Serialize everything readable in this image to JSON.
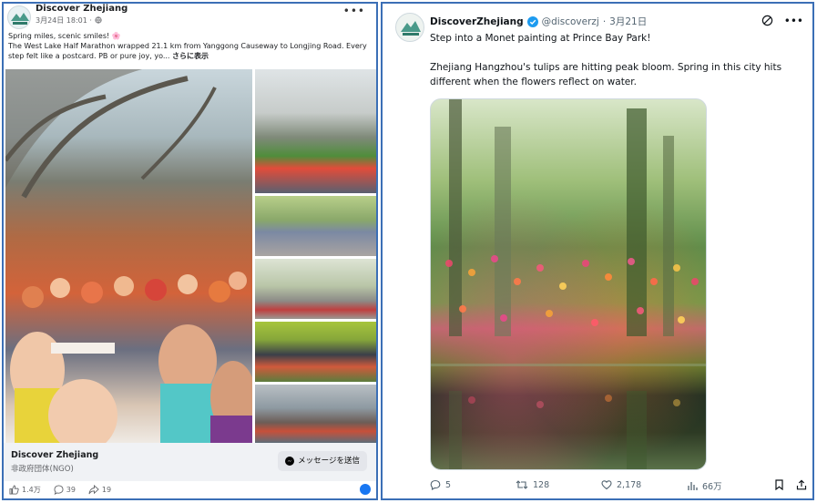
{
  "facebook": {
    "page_name": "Discover Zhejiang",
    "timestamp": "3月24日 18:01",
    "privacy_icon": "globe-icon",
    "post_lines": [
      "Spring miles, scenic smiles! 🌸",
      "The West Lake Half Marathon wrapped 21.1 km from Yanggong Causeway to Longjing Road. Every",
      "step felt like a postcard. PB or pure joy, yo..."
    ],
    "see_more": "さらに表示",
    "organization_name": "Discover Zhejiang",
    "organization_type": "非政府団体(NGO)",
    "message_button": "メッセージを送信",
    "likes": "1.4万",
    "comments": "39",
    "shares": "19"
  },
  "twitter": {
    "display_name": "DiscoverZhejiang",
    "handle": "@discoverzj",
    "separator": "·",
    "date": "3月21日",
    "text_line1": "Step into a Monet painting at Prince Bay Park!",
    "text_line2": "Zhejiang Hangzhou's tulips are hitting peak bloom. Spring in this city hits",
    "text_line3": "different when the flowers reflect on water.",
    "replies": "5",
    "reposts": "128",
    "likes": "2,178",
    "views": "66万",
    "verified_color": "#1d9bf0"
  },
  "colors": {
    "panel_border": "#3b6fb6",
    "facebook_blue": "#1877f2"
  }
}
